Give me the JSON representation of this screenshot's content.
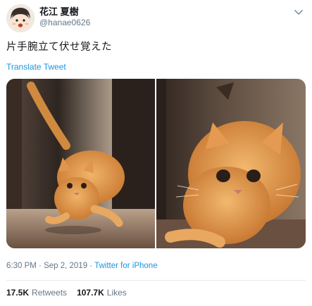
{
  "author": {
    "display_name": "花江 夏樹",
    "handle": "@hanae0626",
    "avatar": "avatar-illustration"
  },
  "menu_icon": "chevron-down-icon",
  "tweet": {
    "text": "片手腕立て伏せ覚えた",
    "translate_label": "Translate Tweet"
  },
  "media": {
    "photos": [
      "orange-cat-photo-1",
      "orange-cat-photo-2"
    ]
  },
  "meta": {
    "time": "6:30 PM",
    "separator1": " · ",
    "date": "Sep 2, 2019",
    "separator2": " · ",
    "source": "Twitter for iPhone"
  },
  "stats": {
    "retweets_count": "17.5K",
    "retweets_label": "Retweets",
    "likes_count": "107.7K",
    "likes_label": "Likes"
  },
  "colors": {
    "link": "#1b95e0",
    "secondary_text": "#657786",
    "primary_text": "#14171a"
  }
}
